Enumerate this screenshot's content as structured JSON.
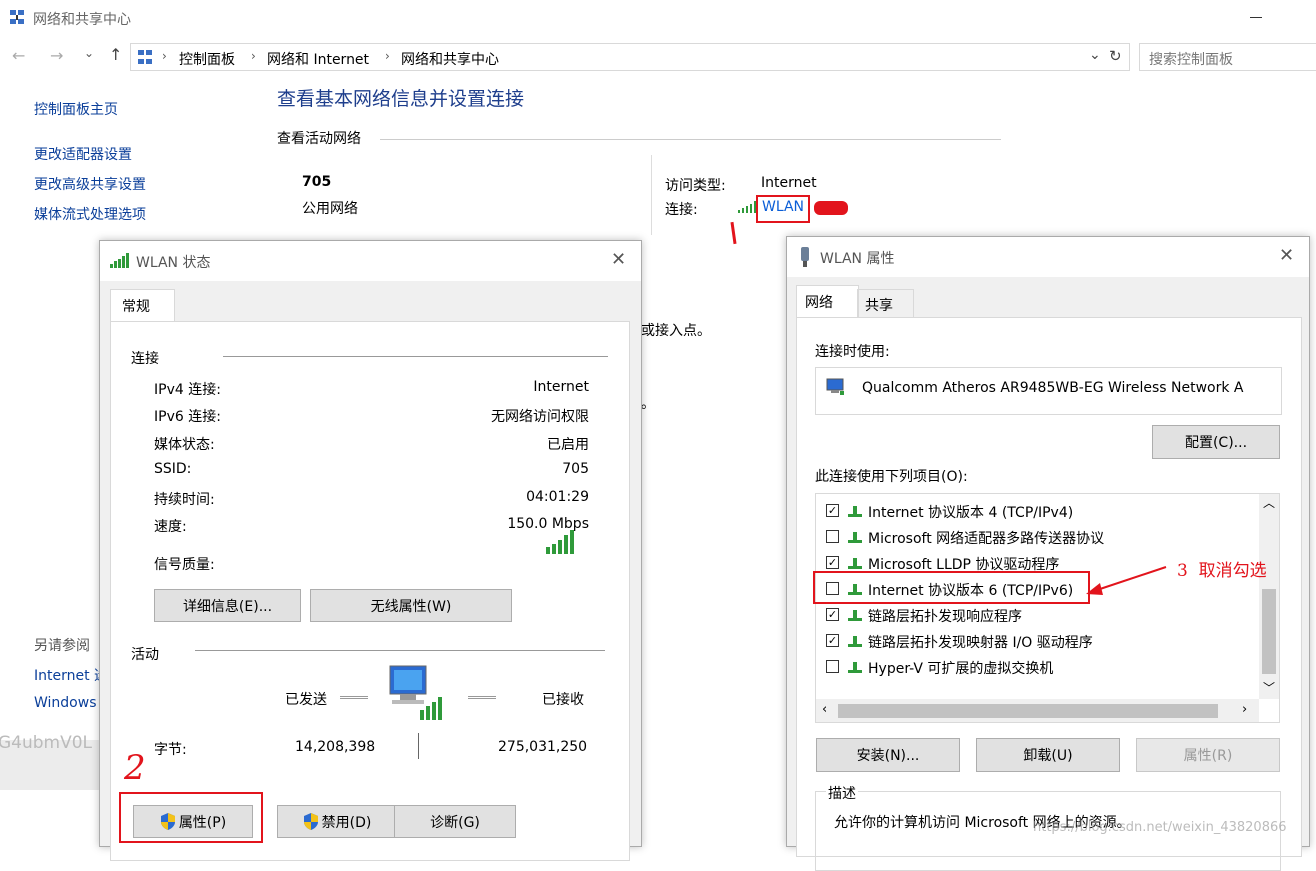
{
  "window": {
    "title": "网络和共享中心",
    "breadcrumb": [
      "控制面板",
      "网络和 Internet",
      "网络和共享中心"
    ],
    "search_placeholder": "搜索控制面板"
  },
  "sidebar": {
    "items": [
      {
        "label": "控制面板主页"
      },
      {
        "label": "更改适配器设置"
      },
      {
        "label": "更改高级共享设置"
      },
      {
        "label": "媒体流式处理选项"
      }
    ],
    "see_also_title": "另请参阅",
    "see_also_items": [
      {
        "label": "Internet 选"
      },
      {
        "label": "Windows"
      }
    ]
  },
  "main": {
    "heading": "查看基本网络信息并设置连接",
    "active_networks_title": "查看活动网络",
    "network_name": "705",
    "network_type": "公用网络",
    "access_type_label": "访问类型:",
    "access_type_value": "Internet",
    "connection_label": "连接:",
    "connection_value": "WLAN",
    "partial_text_1": "或接入点。",
    "partial_text_2": "。",
    "bottom_text": "G4ubmV0L"
  },
  "wlan_status": {
    "title": "WLAN 状态",
    "tab": "常规",
    "connection_section": "连接",
    "rows": [
      {
        "label": "IPv4 连接:",
        "value": "Internet"
      },
      {
        "label": "IPv6 连接:",
        "value": "无网络访问权限"
      },
      {
        "label": "媒体状态:",
        "value": "已启用"
      },
      {
        "label": "SSID:",
        "value": "705"
      },
      {
        "label": "持续时间:",
        "value": "04:01:29"
      },
      {
        "label": "速度:",
        "value": "150.0 Mbps"
      }
    ],
    "signal_label": "信号质量:",
    "details_button": "详细信息(E)...",
    "wireless_props_button": "无线属性(W)",
    "activity_section": "活动",
    "sent_label": "已发送",
    "received_label": "已接收",
    "bytes_label": "字节:",
    "bytes_sent": "14,208,398",
    "bytes_received": "275,031,250",
    "properties_button": "属性(P)",
    "disable_button": "禁用(D)",
    "diagnose_button": "诊断(G)",
    "annotation": "2"
  },
  "wlan_props": {
    "title": "WLAN 属性",
    "tabs": [
      "网络",
      "共享"
    ],
    "connect_using_label": "连接时使用:",
    "adapter_name": "Qualcomm Atheros AR9485WB-EG Wireless Network A",
    "configure_button": "配置(C)...",
    "items_label": "此连接使用下列项目(O):",
    "items": [
      {
        "label": "Internet 协议版本 4 (TCP/IPv4)",
        "checked": true
      },
      {
        "label": "Microsoft 网络适配器多路传送器协议",
        "checked": false
      },
      {
        "label": "Microsoft LLDP 协议驱动程序",
        "checked": true
      },
      {
        "label": "Internet 协议版本 6 (TCP/IPv6)",
        "checked": false
      },
      {
        "label": "链路层拓扑发现响应程序",
        "checked": true
      },
      {
        "label": "链路层拓扑发现映射器 I/O 驱动程序",
        "checked": true
      },
      {
        "label": "Hyper-V 可扩展的虚拟交换机",
        "checked": false
      }
    ],
    "install_button": "安装(N)...",
    "uninstall_button": "卸载(U)",
    "properties_button": "属性(R)",
    "description_title": "描述",
    "description_text": "允许你的计算机访问 Microsoft 网络上的资源。",
    "annotation": "3  取消勾选",
    "watermark": "https://blog.csdn.net/weixin_43820866"
  },
  "colors": {
    "link": "#0b3f9a",
    "heading": "#1e3e8c",
    "annotation_red": "#e2141c",
    "signal_green": "#2f9a3a"
  }
}
